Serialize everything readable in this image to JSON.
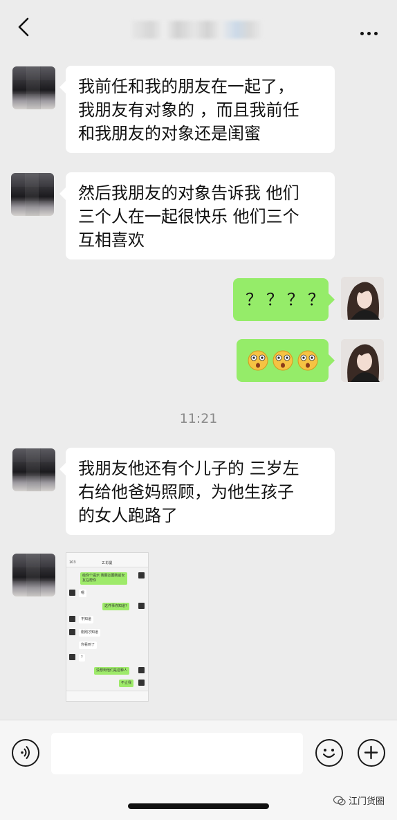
{
  "header": {
    "title": "",
    "back_icon": "chevron-left-icon",
    "more_icon": "more-dots-icon"
  },
  "messages": [
    {
      "side": "left",
      "type": "text",
      "lines": [
        "我前任和我的朋友在一起了，",
        "我朋友有对象的 ，而且我前任",
        "和我朋友的对象还是闺蜜"
      ]
    },
    {
      "side": "left",
      "type": "text",
      "lines": [
        "然后我朋友的对象告诉我 他们",
        "三个人在一起很快乐 他们三个",
        "互相喜欢"
      ]
    },
    {
      "side": "right",
      "type": "text",
      "text": "？？？？"
    },
    {
      "side": "right",
      "type": "emoji",
      "icons": [
        "flushed-emoji-icon",
        "flushed-emoji-icon",
        "flushed-emoji-icon"
      ]
    },
    {
      "side": "left",
      "type": "text",
      "lines": [
        "我朋友他还有个儿子的 三岁左",
        "右给他爸妈照顾，为他生孩子",
        "的女人跑路了"
      ]
    },
    {
      "side": "left",
      "type": "image"
    }
  ],
  "timestamp": "11:21",
  "screenshot": {
    "back_count": "103",
    "title": "Z.彩曼",
    "messages": [
      {
        "side": "right",
        "text": "给你个提示 我朋友圈我前女友在帮你"
      },
      {
        "side": "left",
        "text": "嗯"
      },
      {
        "side": "right",
        "text": "这件事你知道?"
      },
      {
        "side": "left",
        "text": "不知道"
      },
      {
        "side": "left",
        "text": "刚刚才知道"
      },
      {
        "side": "left",
        "text": "你看到了"
      },
      {
        "side": "left",
        "text": "?"
      },
      {
        "side": "right",
        "text": "没想到他们是这种人"
      },
      {
        "side": "right",
        "text": "不止我"
      }
    ]
  },
  "input_bar": {
    "voice_icon": "voice-icon",
    "emoji_icon": "smile-icon",
    "plus_icon": "plus-icon"
  },
  "watermark": "江门货圈"
}
